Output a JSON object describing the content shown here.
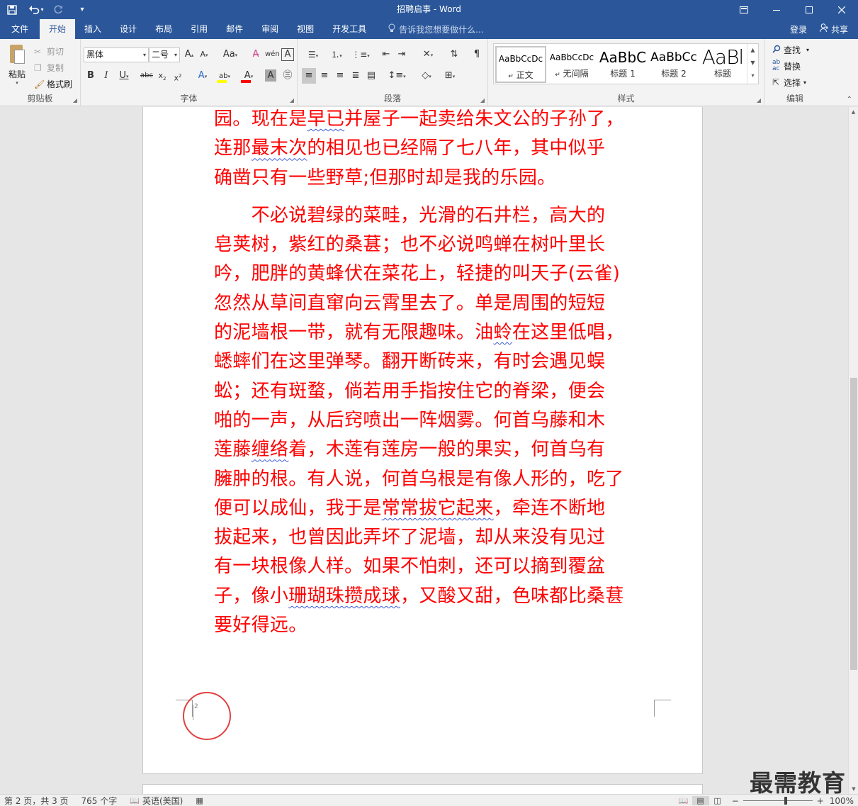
{
  "titlebar": {
    "title": "招聘启事 - Word",
    "qat_save_icon": "save-icon",
    "qat_undo_icon": "undo-icon",
    "qat_redo_icon": "redo-icon",
    "qat_customize_icon": "customize-qat-icon"
  },
  "tabs": {
    "file": "文件",
    "items": [
      "开始",
      "插入",
      "设计",
      "布局",
      "引用",
      "邮件",
      "审阅",
      "视图",
      "开发工具"
    ],
    "active": "开始",
    "tellme": "告诉我您想要做什么...",
    "login": "登录",
    "share": "共享"
  },
  "clipboard": {
    "paste": "粘贴",
    "cut": "剪切",
    "copy": "复制",
    "format_painter": "格式刷",
    "label": "剪贴板"
  },
  "font": {
    "name": "黑体",
    "size": "二号",
    "aa": "Aa",
    "label": "字体"
  },
  "paragraph": {
    "label": "段落"
  },
  "styles": {
    "label": "样式",
    "items": [
      {
        "preview": "AaBbCcDc",
        "name": "正文",
        "prefix": "↵"
      },
      {
        "preview": "AaBbCcDc",
        "name": "无间隔",
        "prefix": "↵"
      },
      {
        "preview": "AaBbC",
        "name": "标题 1",
        "prefix": ""
      },
      {
        "preview": "AaBbCc",
        "name": "标题 2",
        "prefix": ""
      },
      {
        "preview": "AaBl",
        "name": "标题",
        "prefix": ""
      }
    ]
  },
  "editing": {
    "find": "查找",
    "replace": "替换",
    "select": "选择",
    "label": "编辑"
  },
  "document": {
    "para1_lines": [
      "园。现在是早已并屋子一起卖给朱文公的子孙了，",
      "连那最末次的相见也已经隔了七八年，其中似乎",
      "确凿只有一些野草;但那时却是我的乐园。"
    ],
    "para2_lines": [
      "　　不必说碧绿的菜畦，光滑的石井栏，高大的",
      "皂荚树，紫红的桑葚；也不必说鸣蝉在树叶里长",
      "吟，肥胖的黄蜂伏在菜花上，轻捷的叫天子(云雀)",
      "忽然从草间直窜向云霄里去了。单是周围的短短",
      "的泥墙根一带，就有无限趣味。油蛉在这里低唱，",
      "蟋蟀们在这里弹琴。翻开断砖来，有时会遇见蜈",
      "蚣；还有斑蝥，倘若用手指按住它的脊梁，便会",
      "啪的一声，从后窍喷出一阵烟雾。何首乌藤和木",
      "莲藤缠络着，木莲有莲房一般的果实，何首乌有",
      "臃肿的根。有人说，何首乌根是有像人形的，吃了",
      "便可以成仙，我于是常常拔它起来，牵连不断地",
      "拔起来，也曾因此弄坏了泥墙，却从来没有见过",
      "有一块根像人样。如果不怕刺，还可以摘到覆盆",
      "子，像小珊瑚珠攒成球，又酸又甜，色味都比桑葚",
      "要好得远。"
    ],
    "page_number": "2",
    "text_color": "#ff0000"
  },
  "statusbar": {
    "page": "第 2 页，共 3 页",
    "words": "765 个字",
    "language": "英语(美国)",
    "zoom": "100%",
    "zoom_level": 100
  },
  "watermark": "最需教育",
  "colors": {
    "ribbon_blue": "#2b579a",
    "highlight_yellow": "#ffff00",
    "font_color_red": "#ff0000",
    "annotation_red": "#e04040"
  }
}
